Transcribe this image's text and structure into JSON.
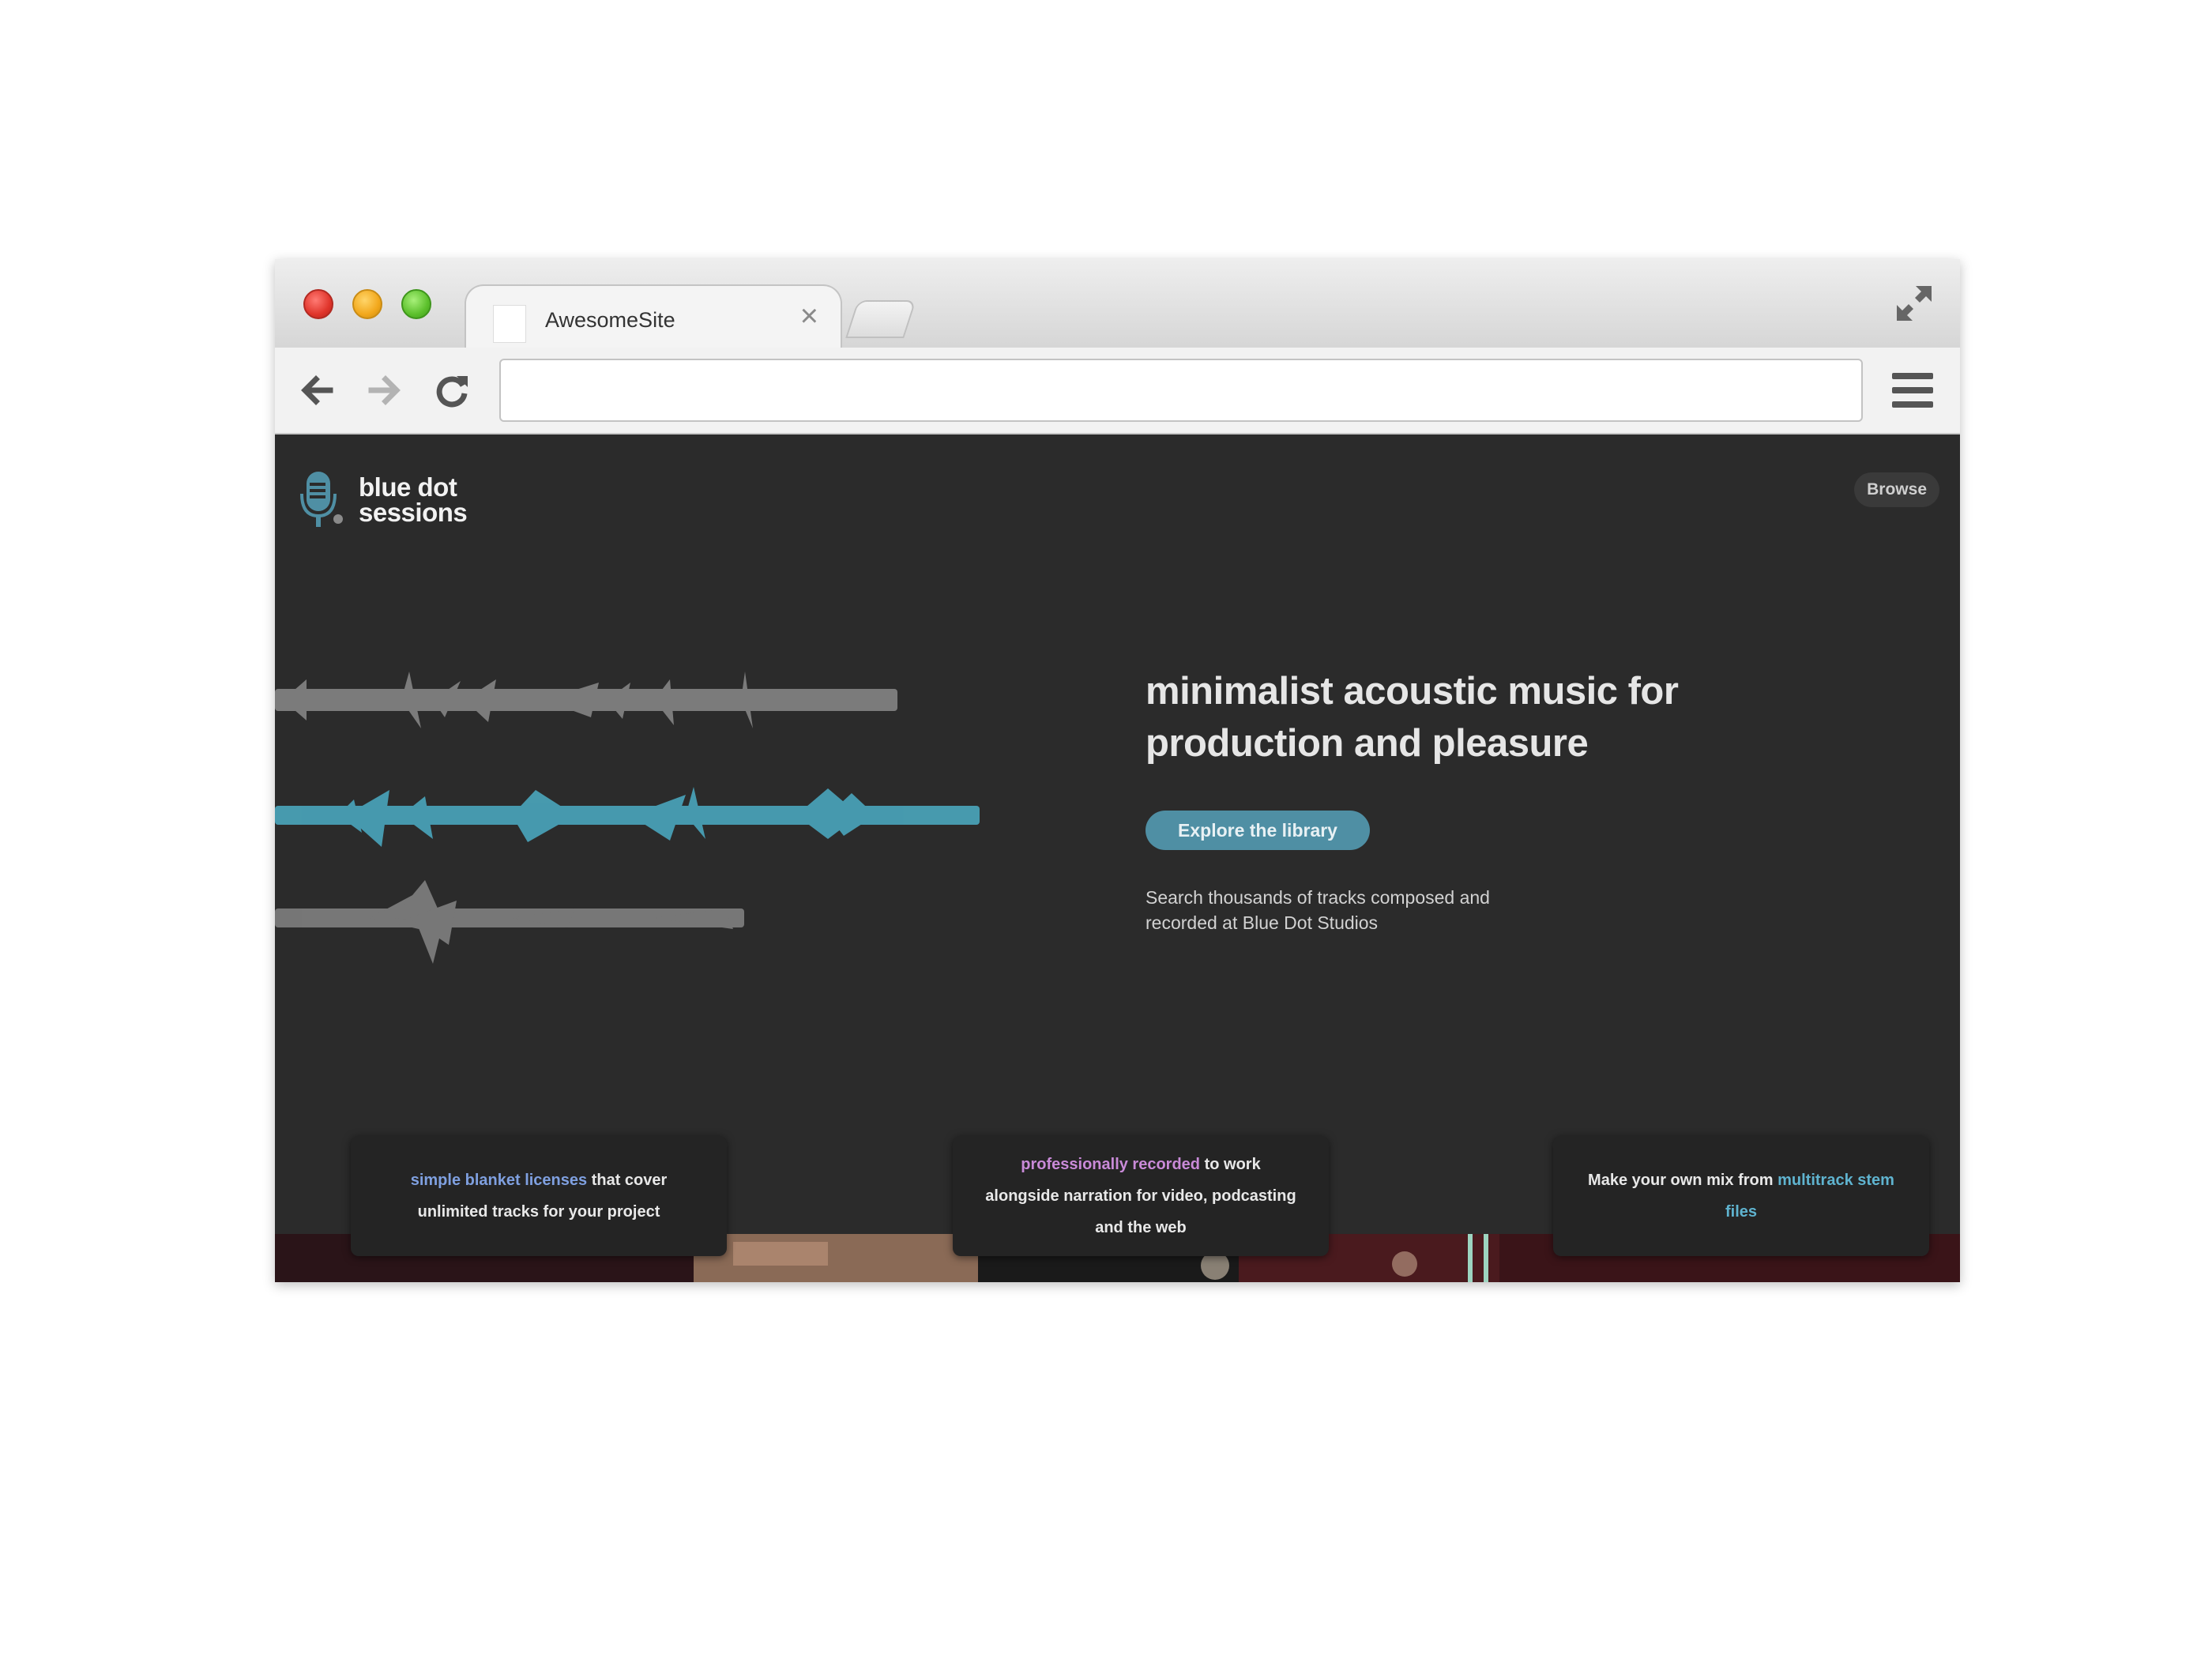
{
  "browser": {
    "tab_title": "AwesomeSite",
    "url": "",
    "colors": {
      "close": "#e0352b",
      "minimize": "#f2a81c",
      "maximize": "#5cc02c"
    }
  },
  "site": {
    "logo_line1": "blue dot",
    "logo_line2": "sessions",
    "browse_label": "Browse",
    "headline": "minimalist acoustic music for production and pleasure",
    "cta_label": "Explore the library",
    "subtext": "Search thousands of tracks composed and recorded at Blue Dot Studios",
    "accent_color": "#4f8fa4",
    "features": [
      {
        "highlight": "simple blanket licenses",
        "text": " that cover unlimited tracks for your project"
      },
      {
        "highlight": "professionally recorded",
        "text": " to work alongside narration for video, podcasting and the web"
      },
      {
        "prefix": "Make your own mix from ",
        "highlight": "multitrack stem files"
      }
    ]
  }
}
